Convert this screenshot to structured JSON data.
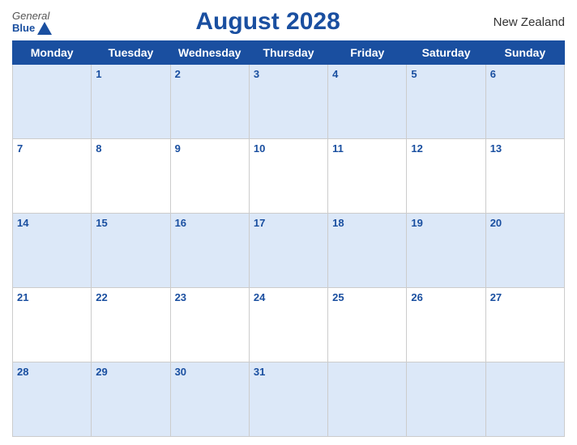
{
  "header": {
    "logo_general": "General",
    "logo_blue": "Blue",
    "title": "August 2028",
    "country": "New Zealand"
  },
  "days": [
    "Monday",
    "Tuesday",
    "Wednesday",
    "Thursday",
    "Friday",
    "Saturday",
    "Sunday"
  ],
  "weeks": [
    [
      null,
      1,
      2,
      3,
      4,
      5,
      6
    ],
    [
      7,
      8,
      9,
      10,
      11,
      12,
      13
    ],
    [
      14,
      15,
      16,
      17,
      18,
      19,
      20
    ],
    [
      21,
      22,
      23,
      24,
      25,
      26,
      27
    ],
    [
      28,
      29,
      30,
      31,
      null,
      null,
      null
    ]
  ]
}
